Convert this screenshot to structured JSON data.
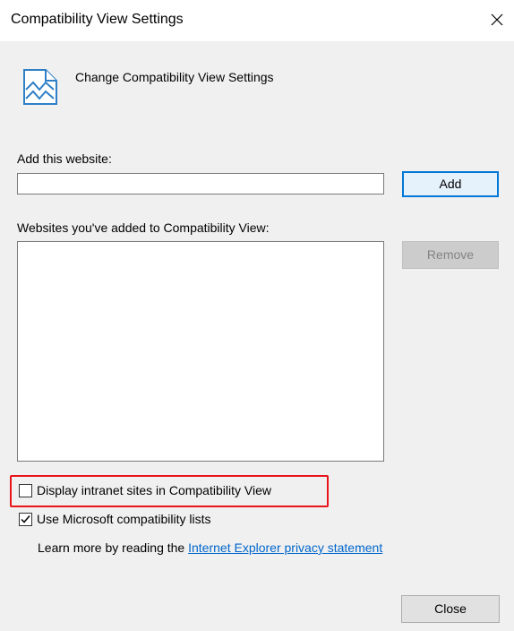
{
  "window": {
    "title": "Compatibility View Settings",
    "close_icon": "close-icon"
  },
  "header": {
    "icon": "compatibility-view-icon",
    "text": "Change Compatibility View Settings"
  },
  "add_section": {
    "label": "Add this website:",
    "input_value": "",
    "add_button_label": "Add"
  },
  "list_section": {
    "label": "Websites you've added to Compatibility View:",
    "items": [],
    "remove_button_label": "Remove"
  },
  "options": {
    "display_intranet": {
      "label": "Display intranet sites in Compatibility View",
      "checked": false
    },
    "use_ms_lists": {
      "label": "Use Microsoft compatibility lists",
      "checked": true
    }
  },
  "learn_more": {
    "prefix": "Learn more by reading the ",
    "link_text": "Internet Explorer privacy statement"
  },
  "footer": {
    "close_button_label": "Close"
  },
  "colors": {
    "highlight_border": "#e8141a",
    "link": "#0066cc",
    "default_button_border": "#0078d7"
  }
}
